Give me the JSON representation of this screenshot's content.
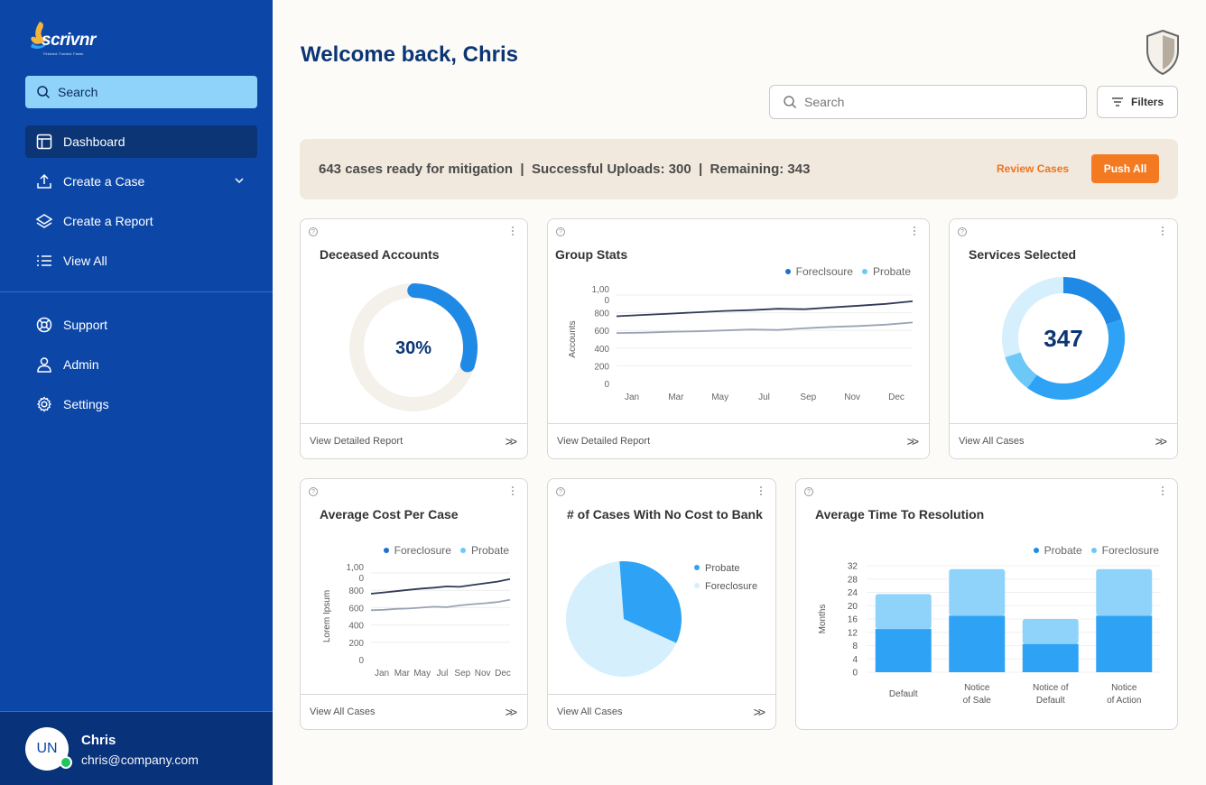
{
  "app": {
    "brand": "scrivnr",
    "tagline": "Finished. Funded. Faster."
  },
  "sidebar": {
    "search_label": "Search",
    "items": [
      {
        "label": "Dashboard",
        "icon": "layout-icon"
      },
      {
        "label": "Create a Case",
        "icon": "upload-icon"
      },
      {
        "label": "Create a Report",
        "icon": "layers-icon"
      },
      {
        "label": "View All",
        "icon": "list-icon"
      },
      {
        "label": "Support",
        "icon": "lifebuoy-icon"
      },
      {
        "label": "Admin",
        "icon": "user-icon"
      },
      {
        "label": "Settings",
        "icon": "gear-icon"
      }
    ],
    "user": {
      "initials": "UN",
      "name": "Chris",
      "email": "chris@company.com"
    }
  },
  "header": {
    "welcome": "Welcome back, Chris",
    "search_placeholder": "Search",
    "filters_label": "Filters"
  },
  "banner": {
    "text": "643 cases ready for mitigation  |  Successful Uploads: 300  |  Remaining: 343",
    "review_label": "Review Cases",
    "push_label": "Push All"
  },
  "colors": {
    "primary": "#0c47a8",
    "accent": "#f47a22",
    "series_dark": "#2f3a56",
    "series_light": "#9aa3b5",
    "bar_dark": "#2ea3f5",
    "bar_light": "#8fd3fb"
  },
  "cards": {
    "deceased": {
      "title": "Deceased Accounts",
      "value_label": "30%",
      "footer": "View Detailed Report"
    },
    "group": {
      "title": "Group Stats",
      "footer": "View Detailed Report"
    },
    "services": {
      "title": "Services Selected",
      "value_label": "347",
      "footer": "View All Cases"
    },
    "avg_cost": {
      "title": "Average Cost Per Case",
      "footer": "View All Cases"
    },
    "no_cost": {
      "title": "# of Cases With No Cost to Bank",
      "footer": "View All Cases"
    },
    "avg_time": {
      "title": "Average Time To Resolution"
    }
  },
  "chart_data": [
    {
      "type": "pie",
      "title": "Deceased Accounts",
      "values": [
        30,
        70
      ],
      "center_label": "30%"
    },
    {
      "type": "line",
      "title": "Group Stats",
      "xlabel": "",
      "ylabel": "Accounts",
      "x": [
        "Jan",
        "Mar",
        "May",
        "Jul",
        "Sep",
        "Nov",
        "Dec"
      ],
      "y_ticks": [
        "1,00\n0",
        "800",
        "600",
        "400",
        "200",
        "0"
      ],
      "ylim": [
        0,
        1000
      ],
      "series": [
        {
          "name": "Foreclsoure",
          "values": [
            760,
            775,
            790,
            805,
            820,
            830,
            845,
            840,
            860,
            880,
            900,
            930
          ]
        },
        {
          "name": "Probate",
          "values": [
            570,
            575,
            585,
            590,
            600,
            610,
            605,
            625,
            640,
            650,
            665,
            690
          ]
        }
      ],
      "legend": "top-right"
    },
    {
      "type": "pie",
      "title": "Services Selected",
      "center_label": "347",
      "values": [
        20,
        40,
        10,
        30
      ]
    },
    {
      "type": "line",
      "title": "Average Cost Per Case",
      "ylabel": "Lorem Ipsum",
      "x": [
        "Jan",
        "Mar",
        "May",
        "Jul",
        "Sep",
        "Nov",
        "Dec"
      ],
      "y_ticks": [
        "1,00\n0",
        "800",
        "600",
        "400",
        "200",
        "0"
      ],
      "ylim": [
        0,
        1000
      ],
      "series": [
        {
          "name": "Foreclosure",
          "values": [
            760,
            775,
            790,
            805,
            820,
            830,
            845,
            840,
            860,
            880,
            900,
            930
          ]
        },
        {
          "name": "Probate",
          "values": [
            570,
            575,
            585,
            590,
            600,
            610,
            605,
            625,
            640,
            650,
            665,
            690
          ]
        }
      ],
      "legend": "top-right"
    },
    {
      "type": "pie",
      "title": "# of Cases With No Cost to Bank",
      "slices": [
        {
          "name": "Probate",
          "value": 33
        },
        {
          "name": "Foreclosure",
          "value": 67
        }
      ]
    },
    {
      "type": "bar",
      "title": "Average Time To Resolution",
      "ylabel": "Months",
      "categories": [
        "Default",
        "Notice\nof Sale",
        "Notice of\nDefault",
        "Notice\nof Action"
      ],
      "y_ticks": [
        "32",
        "28",
        "24",
        "20",
        "16",
        "12",
        "8",
        "4",
        "0"
      ],
      "ylim": [
        0,
        32
      ],
      "series": [
        {
          "name": "Probate",
          "values": [
            13,
            17,
            8.5,
            17
          ]
        },
        {
          "name": "Foreclosure",
          "values": [
            10.5,
            14,
            7.5,
            14
          ]
        }
      ],
      "stacked": true,
      "legend": "top-right"
    }
  ]
}
